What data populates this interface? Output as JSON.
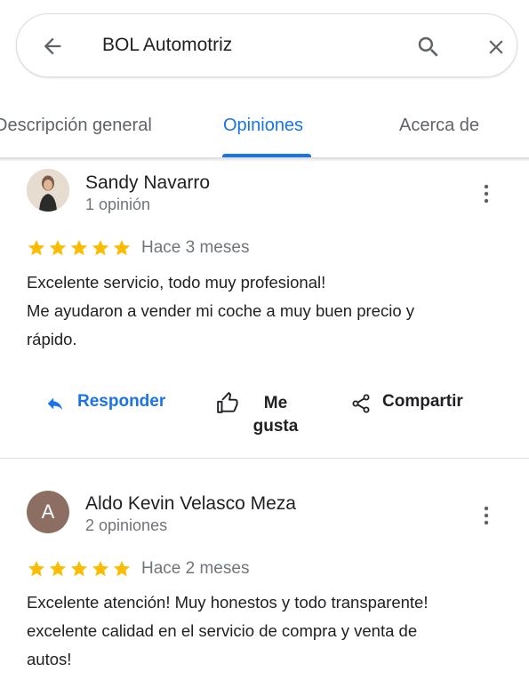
{
  "search": {
    "query": "BOL Automotriz"
  },
  "tabs": [
    {
      "label": "Descripción general"
    },
    {
      "label": "Opiniones",
      "active": true
    },
    {
      "label": "Acerca de"
    }
  ],
  "reviews": [
    {
      "name": "Sandy Navarro",
      "count": "1 opinión",
      "rating": 5,
      "time": "Hace 3 meses",
      "text_lines": [
        "Excelente servicio, todo muy profesional!",
        "Me ayudaron a vender mi coche a muy buen precio y",
        "rápido."
      ],
      "avatar": "photo"
    },
    {
      "name": "Aldo Kevin Velasco Meza",
      "count": "2 opiniones",
      "rating": 5,
      "time": "Hace 2 meses",
      "text_lines": [
        "Excelente atención! Muy honestos y todo transparente!",
        "excelente calidad en el servicio de compra y venta de",
        "autos!"
      ],
      "avatar_letter": "A",
      "avatar_color": "#8d6e63"
    }
  ],
  "actions": {
    "reply": "Responder",
    "like_line1": "Me",
    "like_line2": "gusta",
    "share": "Compartir"
  },
  "colors": {
    "accent": "#1a73e8",
    "star": "#fbbc04",
    "muted": "#70757a"
  }
}
